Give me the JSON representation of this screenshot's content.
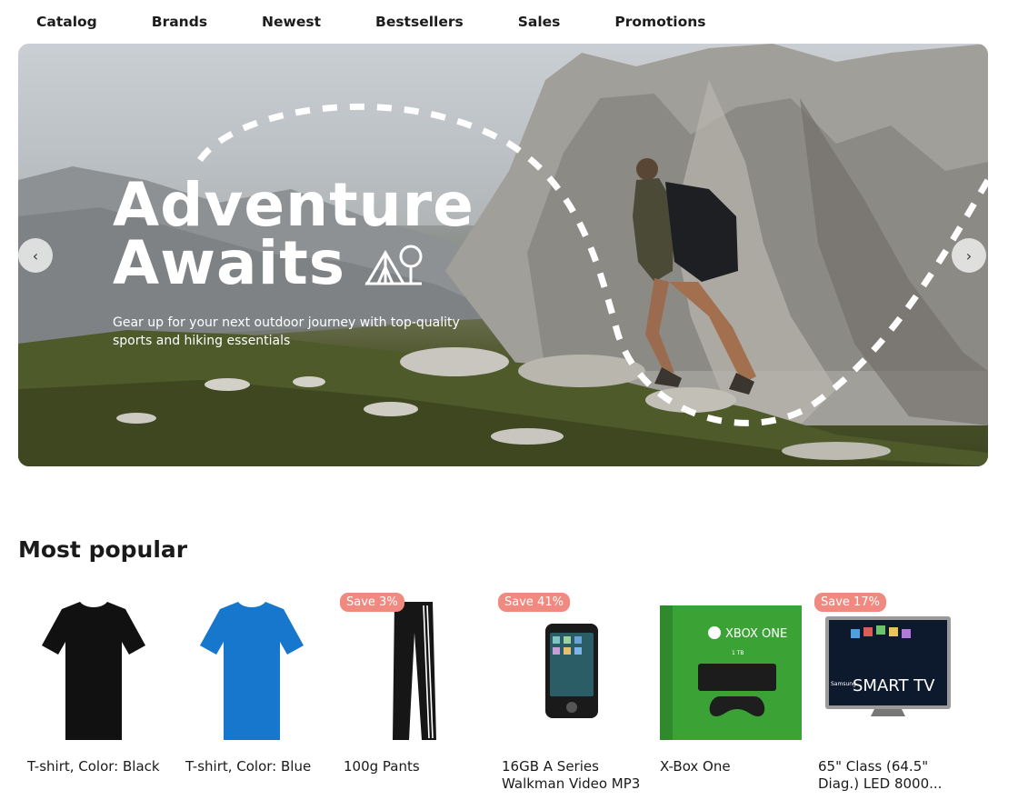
{
  "nav": {
    "items": [
      "Catalog",
      "Brands",
      "Newest",
      "Bestsellers",
      "Sales",
      "Promotions"
    ]
  },
  "hero": {
    "title_line1": "Adventure",
    "title_line2": "Awaits",
    "subtitle": "Gear up for your next outdoor journey with top-quality sports and hiking essentials",
    "prev_label": "‹",
    "next_label": "›"
  },
  "section": {
    "title": "Most popular"
  },
  "products": [
    {
      "name": "T-shirt, Color: Black",
      "badge": ""
    },
    {
      "name": "T-shirt, Color: Blue",
      "badge": ""
    },
    {
      "name": "100g Pants",
      "badge": "Save 3%"
    },
    {
      "name": "16GB A Series Walkman Video MP3",
      "badge": "Save 41%"
    },
    {
      "name": "X-Box One",
      "badge": ""
    },
    {
      "name": "65\" Class (64.5\" Diag.) LED 8000...",
      "badge": "Save 17%"
    }
  ],
  "product_images": {
    "xbox_logo": "XBOX ONE",
    "xbox_capacity": "1 TB",
    "tv_brand": "Samsung",
    "tv_logo": "SMART TV"
  },
  "colors": {
    "badge": "#f08a80",
    "xbox_green": "#3ba336",
    "tshirt_blue": "#1677cc"
  }
}
